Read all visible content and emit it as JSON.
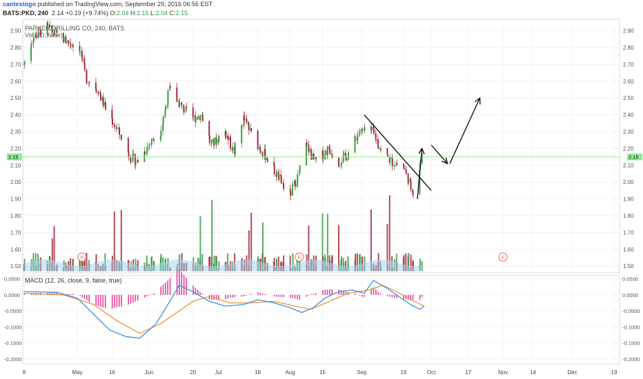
{
  "header": {
    "author": "cantestogo",
    "published": " published on TradingView.com, September 29, 2016 06:56 EST",
    "symbol": "BATS:PKD, 240",
    "last": "2.14",
    "change": "+0.19 (+9.74%)",
    "o_label": "O:",
    "o": "2.04",
    "h_label": "H:",
    "h": "2.15",
    "l_label": "L:",
    "l": "2.04",
    "c_label": "C:",
    "c": "2.15"
  },
  "overlay": {
    "title": "PARKER DRILLING CO, 240, BATS",
    "volume_label": "Vol (20, false)"
  },
  "colors": {
    "up": "#3a9a45",
    "down": "#a52a3a",
    "price_line": "#8ef08e",
    "macd": "#3d8fe0",
    "signal": "#f0923a",
    "hist": "#e0409a",
    "vol_ma": "#a9d6f2"
  },
  "chart_data": [
    {
      "type": "candlestick",
      "title": "PARKER DRILLING CO, 240, BATS",
      "y_ticks": [
        "2.90",
        "2.80",
        "2.70",
        "2.60",
        "2.50",
        "2.40",
        "2.30",
        "2.20",
        "2.10",
        "2.00",
        "1.90",
        "1.80",
        "1.70",
        "1.60",
        "1.50"
      ],
      "ylim": [
        1.46,
        2.96
      ],
      "current_price": 2.15,
      "current_price_label": "2.15",
      "x_ticks": [
        "8",
        "May",
        "16",
        "Jun",
        "20",
        "Jul",
        "18",
        "Aug",
        "15",
        "Sep",
        "19",
        "Oct",
        "17",
        "Nov",
        "14",
        "Dec",
        "19"
      ],
      "earnings_marker": "E",
      "price_path": [
        [
          "2016-04-08",
          2.7
        ],
        [
          "2016-04-12",
          2.86
        ],
        [
          "2016-04-18",
          2.92
        ],
        [
          "2016-04-25",
          2.85
        ],
        [
          "2016-05-02",
          2.8
        ],
        [
          "2016-05-05",
          2.62
        ],
        [
          "2016-05-10",
          2.55
        ],
        [
          "2016-05-14",
          2.42
        ],
        [
          "2016-05-19",
          2.3
        ],
        [
          "2016-05-24",
          2.15
        ],
        [
          "2016-05-27",
          2.12
        ],
        [
          "2016-06-01",
          2.22
        ],
        [
          "2016-06-06",
          2.3
        ],
        [
          "2016-06-10",
          2.55
        ],
        [
          "2016-06-15",
          2.45
        ],
        [
          "2016-06-20",
          2.38
        ],
        [
          "2016-06-24",
          2.4
        ],
        [
          "2016-06-28",
          2.22
        ],
        [
          "2016-07-04",
          2.3
        ],
        [
          "2016-07-08",
          2.18
        ],
        [
          "2016-07-12",
          2.38
        ],
        [
          "2016-07-18",
          2.22
        ],
        [
          "2016-07-22",
          2.15
        ],
        [
          "2016-07-26",
          2.05
        ],
        [
          "2016-08-01",
          1.92
        ],
        [
          "2016-08-05",
          2.05
        ],
        [
          "2016-08-08",
          2.22
        ],
        [
          "2016-08-12",
          2.12
        ],
        [
          "2016-08-18",
          2.2
        ],
        [
          "2016-08-22",
          2.12
        ],
        [
          "2016-08-26",
          2.16
        ],
        [
          "2016-08-31",
          2.3
        ],
        [
          "2016-09-06",
          2.3
        ],
        [
          "2016-09-09",
          2.2
        ],
        [
          "2016-09-14",
          2.12
        ],
        [
          "2016-09-19",
          2.1
        ],
        [
          "2016-09-22",
          1.98
        ],
        [
          "2016-09-24",
          1.93
        ],
        [
          "2016-09-27",
          2.15
        ]
      ],
      "projection_arrows": [
        {
          "points": [
            [
              "2016-09-25",
              1.9
            ],
            [
              "2016-09-26",
              2.06
            ],
            [
              "2016-09-27",
              2.2
            ]
          ]
        },
        {
          "points": [
            [
              "2016-10-01",
              2.22
            ],
            [
              "2016-10-08",
              2.11
            ]
          ]
        },
        {
          "points": [
            [
              "2016-10-09",
              2.11
            ],
            [
              "2016-10-22",
              2.5
            ]
          ]
        }
      ],
      "trend_line": [
        [
          "2016-09-02",
          2.4
        ],
        [
          "2016-10-01",
          1.95
        ]
      ]
    },
    {
      "type": "bar",
      "title": "Vol (20, false)",
      "y_ticks": [
        "1.80",
        "1.70",
        "1.60",
        "1.50"
      ],
      "comment": "volume histogram scaled on price axis"
    },
    {
      "type": "line",
      "title": "MACD (12, 26, close, 9, false, true)",
      "y_ticks": [
        "0.0500",
        "0.0000",
        "-0.0500",
        "-0.1000",
        "-0.1500",
        "-0.2000"
      ],
      "ylim": [
        -0.215,
        0.06
      ],
      "macd": [
        [
          "2016-04-08",
          0.01
        ],
        [
          "2016-04-22",
          0.008
        ],
        [
          "2016-05-01",
          -0.01
        ],
        [
          "2016-05-08",
          -0.06
        ],
        [
          "2016-05-15",
          -0.11
        ],
        [
          "2016-05-22",
          -0.13
        ],
        [
          "2016-05-28",
          -0.135
        ],
        [
          "2016-06-04",
          -0.09
        ],
        [
          "2016-06-10",
          -0.02
        ],
        [
          "2016-06-14",
          0.03
        ],
        [
          "2016-06-20",
          0.01
        ],
        [
          "2016-06-27",
          -0.02
        ],
        [
          "2016-07-04",
          -0.035
        ],
        [
          "2016-07-12",
          -0.03
        ],
        [
          "2016-07-18",
          -0.015
        ],
        [
          "2016-07-25",
          -0.025
        ],
        [
          "2016-08-01",
          -0.04
        ],
        [
          "2016-08-06",
          -0.055
        ],
        [
          "2016-08-11",
          -0.04
        ],
        [
          "2016-08-16",
          -0.01
        ],
        [
          "2016-08-22",
          0.01
        ],
        [
          "2016-08-28",
          0.015
        ],
        [
          "2016-09-02",
          0.005
        ],
        [
          "2016-09-06",
          0.045
        ],
        [
          "2016-09-12",
          0.02
        ],
        [
          "2016-09-18",
          -0.01
        ],
        [
          "2016-09-22",
          -0.03
        ],
        [
          "2016-09-26",
          -0.045
        ],
        [
          "2016-09-28",
          -0.035
        ]
      ],
      "signal": [
        [
          "2016-04-08",
          0.005
        ],
        [
          "2016-04-25",
          0.0
        ],
        [
          "2016-05-08",
          -0.03
        ],
        [
          "2016-05-18",
          -0.08
        ],
        [
          "2016-05-28",
          -0.12
        ],
        [
          "2016-06-06",
          -0.09
        ],
        [
          "2016-06-14",
          -0.05
        ],
        [
          "2016-06-20",
          -0.02
        ],
        [
          "2016-06-27",
          -0.005
        ],
        [
          "2016-07-06",
          -0.025
        ],
        [
          "2016-07-15",
          -0.025
        ],
        [
          "2016-07-25",
          -0.02
        ],
        [
          "2016-08-03",
          -0.035
        ],
        [
          "2016-08-10",
          -0.045
        ],
        [
          "2016-08-18",
          -0.02
        ],
        [
          "2016-08-26",
          0.005
        ],
        [
          "2016-09-04",
          0.015
        ],
        [
          "2016-09-10",
          0.03
        ],
        [
          "2016-09-16",
          0.01
        ],
        [
          "2016-09-22",
          -0.015
        ],
        [
          "2016-09-28",
          -0.035
        ]
      ]
    }
  ]
}
